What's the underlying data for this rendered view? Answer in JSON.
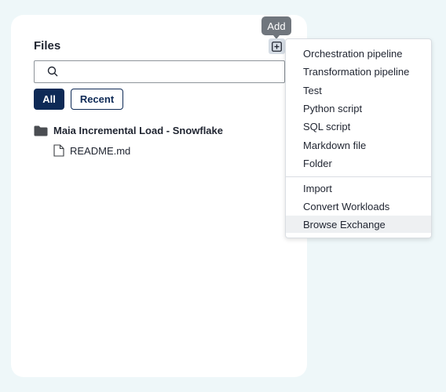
{
  "files_panel": {
    "title": "Files",
    "add_tooltip": "Add",
    "search": {
      "value": "",
      "placeholder": ""
    },
    "filters": {
      "all": "All",
      "recent": "Recent",
      "active": "All"
    },
    "tree": [
      {
        "type": "folder",
        "label": "Maia Incremental Load - Snowflake"
      },
      {
        "type": "file",
        "label": "README.md"
      }
    ]
  },
  "add_menu": {
    "group1": [
      "Orchestration pipeline",
      "Transformation pipeline",
      "Test",
      "Python script",
      "SQL script",
      "Markdown file",
      "Folder"
    ],
    "group2": [
      "Import",
      "Convert Workloads",
      "Browse Exchange"
    ],
    "highlighted": "Browse Exchange"
  },
  "colors": {
    "page_bg": "#eef7f9",
    "primary": "#0e2a56",
    "tooltip_bg": "#70767d"
  },
  "icons": [
    "search-icon",
    "add-square-icon",
    "folder-icon",
    "file-icon"
  ]
}
